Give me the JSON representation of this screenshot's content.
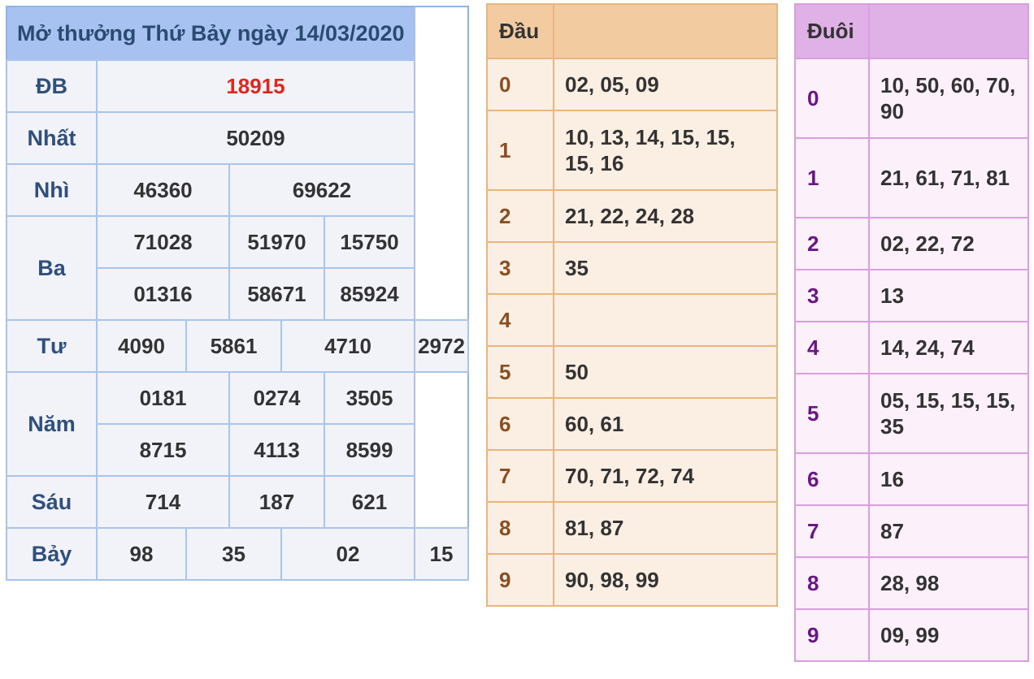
{
  "results": {
    "title": "Mở thưởng Thứ Bảy ngày 14/03/2020",
    "db": {
      "label": "ĐB",
      "value": "18915"
    },
    "nhat": {
      "label": "Nhất",
      "value": "50209"
    },
    "nhi": {
      "label": "Nhì",
      "values": [
        "46360",
        "69622"
      ]
    },
    "ba": {
      "label": "Ba",
      "values": [
        "71028",
        "51970",
        "15750",
        "01316",
        "58671",
        "85924"
      ]
    },
    "tu": {
      "label": "Tư",
      "values": [
        "4090",
        "5861",
        "4710",
        "2972"
      ]
    },
    "nam": {
      "label": "Năm",
      "values": [
        "0181",
        "0274",
        "3505",
        "8715",
        "4113",
        "8599"
      ]
    },
    "sau": {
      "label": "Sáu",
      "values": [
        "714",
        "187",
        "621"
      ]
    },
    "bay": {
      "label": "Bảy",
      "values": [
        "98",
        "35",
        "02",
        "15"
      ]
    }
  },
  "dau": {
    "header": "Đầu",
    "rows": [
      {
        "key": "0",
        "value": "02, 05, 09"
      },
      {
        "key": "1",
        "value": "10, 13, 14, 15, 15, 15, 16"
      },
      {
        "key": "2",
        "value": "21, 22, 24, 28"
      },
      {
        "key": "3",
        "value": "35"
      },
      {
        "key": "4",
        "value": ""
      },
      {
        "key": "5",
        "value": "50"
      },
      {
        "key": "6",
        "value": "60, 61"
      },
      {
        "key": "7",
        "value": "70, 71, 72, 74"
      },
      {
        "key": "8",
        "value": "81, 87"
      },
      {
        "key": "9",
        "value": "90, 98, 99"
      }
    ]
  },
  "duoi": {
    "header": "Đuôi",
    "rows": [
      {
        "key": "0",
        "value": "10, 50, 60, 70, 90"
      },
      {
        "key": "1",
        "value": "21, 61, 71, 81"
      },
      {
        "key": "2",
        "value": "02, 22, 72"
      },
      {
        "key": "3",
        "value": "13"
      },
      {
        "key": "4",
        "value": "14, 24, 74"
      },
      {
        "key": "5",
        "value": "05, 15, 15, 15, 35"
      },
      {
        "key": "6",
        "value": "16"
      },
      {
        "key": "7",
        "value": "87"
      },
      {
        "key": "8",
        "value": "28, 98"
      },
      {
        "key": "9",
        "value": "09, 99"
      }
    ]
  },
  "colors": {
    "special_prize": "#e0271f",
    "results_header": "#a7c2f0",
    "dau_header": "#f3cba0",
    "duoi_header": "#e0b1e6"
  }
}
